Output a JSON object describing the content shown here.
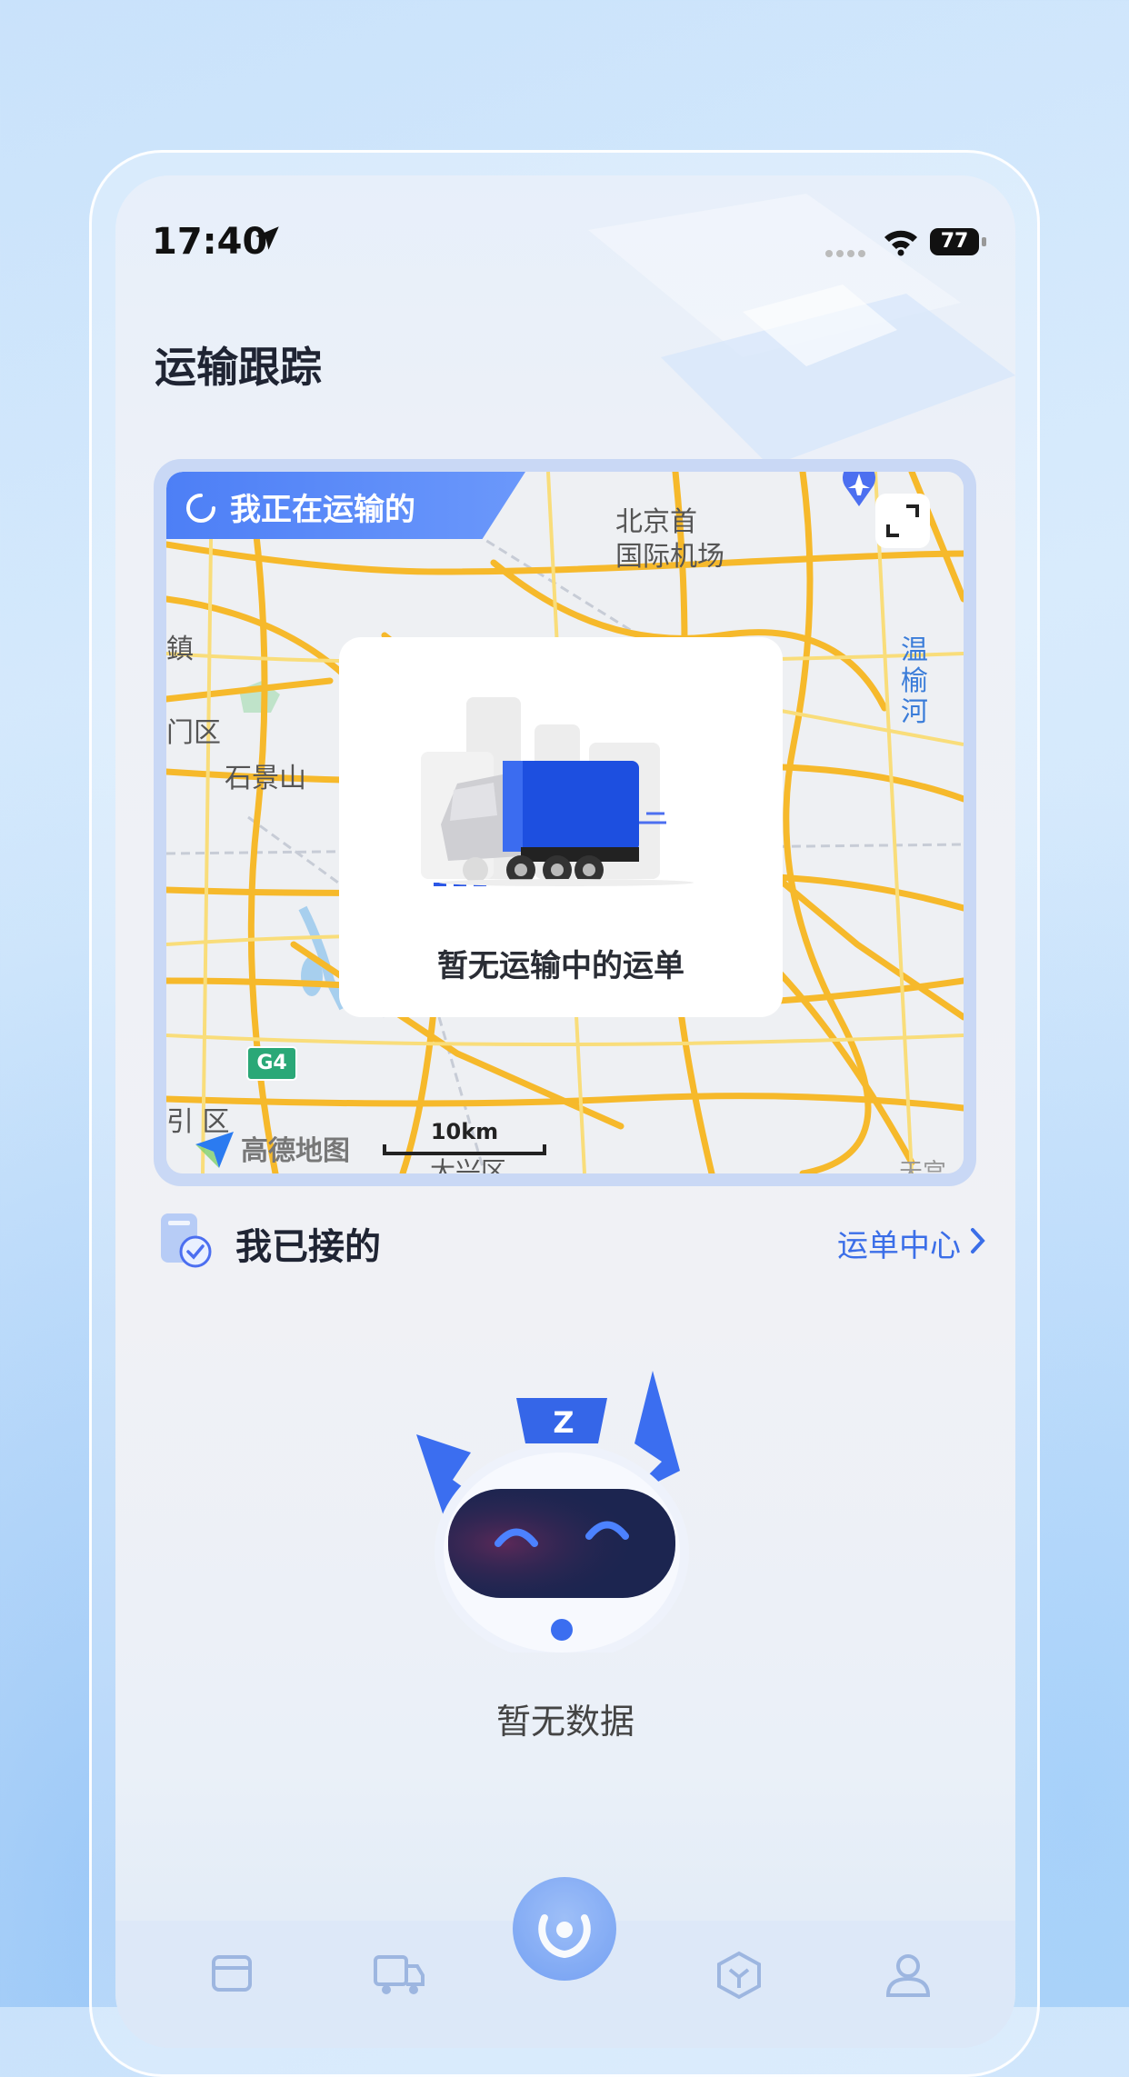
{
  "status_bar": {
    "time": "17:40",
    "battery": "77"
  },
  "page": {
    "title": "运输跟踪"
  },
  "map_card": {
    "tag_label": "我正在运输的",
    "labels": {
      "airport_line1": "北京首",
      "airport_line2": "国际机场",
      "left_town": "鎮",
      "left_district": "门区",
      "shijingshan": "石景山",
      "river": "温榆河",
      "bottom_left": "引 区",
      "bottom_center": "大兴区",
      "bottom_right": "天宫",
      "highway": "G4"
    },
    "provider": "高德地图",
    "scale": "10km",
    "empty_text": "暂无运输中的运单"
  },
  "accepted_section": {
    "title": "我已接的",
    "link": "运单中心",
    "empty_text": "暂无数据"
  },
  "tabbar": {
    "items": [
      {
        "icon": "wallet-icon"
      },
      {
        "icon": "truck-icon"
      },
      {
        "icon": "scan-icon"
      },
      {
        "icon": "box-icon"
      },
      {
        "icon": "user-icon"
      }
    ]
  },
  "colors": {
    "accent": "#3b6ee8",
    "tag": "#5a88f8",
    "road": "#f6b92b"
  }
}
